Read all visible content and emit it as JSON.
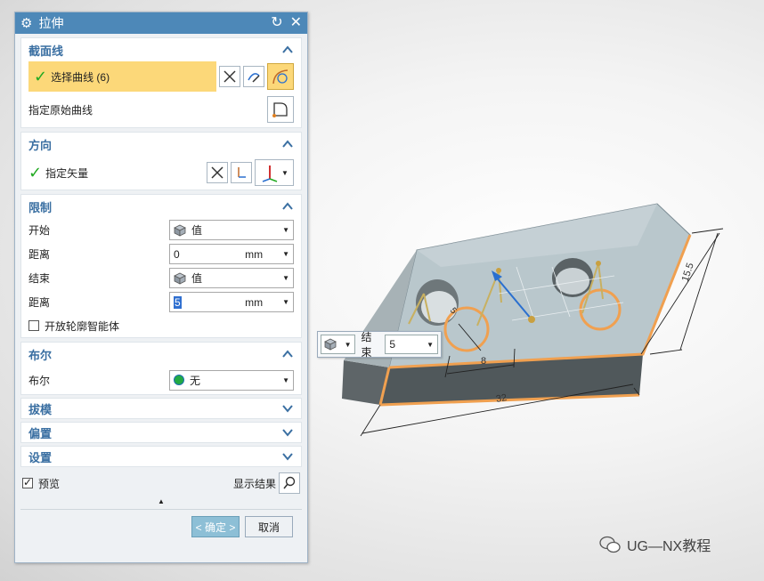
{
  "dialog": {
    "title": "拉伸",
    "sections": {
      "section_curve": {
        "header": "截面线",
        "select_curve": "选择曲线 (6)",
        "specify_original": "指定原始曲线"
      },
      "direction": {
        "header": "方向",
        "specify_vector": "指定矢量"
      },
      "limits": {
        "header": "限制",
        "start_label": "开始",
        "start_value": "值",
        "distance1_label": "距离",
        "distance1_value": "0",
        "distance1_unit": "mm",
        "end_label": "结束",
        "end_value": "值",
        "distance2_label": "距离",
        "distance2_value": "5",
        "distance2_unit": "mm",
        "open_profile": "开放轮廓智能体"
      },
      "boolean": {
        "header": "布尔",
        "label": "布尔",
        "value": "无"
      },
      "draft": {
        "header": "拔模"
      },
      "offset": {
        "header": "偏置"
      },
      "settings": {
        "header": "设置"
      }
    },
    "preview_label": "预览",
    "show_result": "显示结果",
    "ok": "< 确定 >",
    "cancel": "取消"
  },
  "floatbar": {
    "label": "结束",
    "value": "5"
  },
  "dimensions": {
    "d1": "15.5",
    "d2": "8",
    "d3": "32",
    "d4": "5"
  },
  "watermark": "UG—NX教程",
  "colors": {
    "title_bar": "#4d88b8",
    "section_header": "#3a6fa2",
    "selection_highlight": "#fcd879",
    "edge_highlight": "#f0a050"
  }
}
